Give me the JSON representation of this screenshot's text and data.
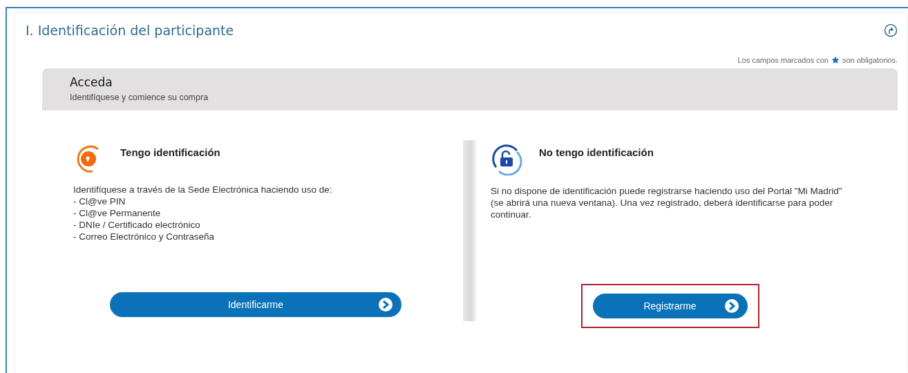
{
  "section": {
    "title": "I. Identificación del participante",
    "required_note_before": "Los campos marcados con",
    "required_note_after": "son obligatorios."
  },
  "header": {
    "title": "Acceda",
    "subtitle": "Identifíquese y comience su compra"
  },
  "options": [
    {
      "kind": "login",
      "title": "Tengo identificación",
      "lines": [
        "Identifíquese a través de la Sede Electrónica haciendo uso de:",
        "- Cl@ve PIN",
        "- Cl@ve Permanente",
        "- DNIe / Certificado electrónico",
        "- Correo Electrónico y Contraseña"
      ],
      "button": "Identificarme",
      "highlighted": false
    },
    {
      "kind": "register",
      "title": "No tengo identificación",
      "lines": [
        "Si no dispone de identificación puede registrarse haciendo uso del Portal \"Mi Madrid\" (se abrirá una nueva ventana). Una vez registrado, deberá identificarse para poder continuar."
      ],
      "button": "Registrarme",
      "highlighted": true
    }
  ]
}
